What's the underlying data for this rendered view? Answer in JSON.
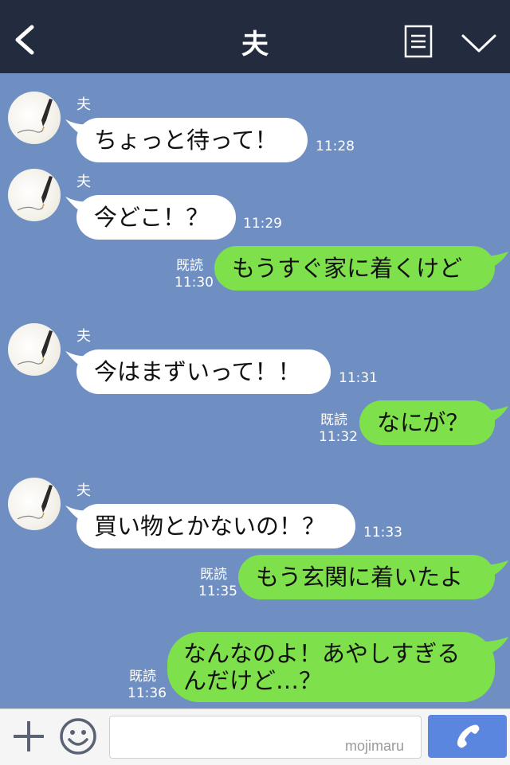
{
  "header": {
    "title": "夫",
    "back_icon": "chevron-left-icon",
    "menu_icon": "notes-icon",
    "collapse_icon": "chevron-down-icon"
  },
  "messages": [
    {
      "sender": "夫",
      "text": "ちょっと待って！",
      "time": "11:28"
    },
    {
      "sender": "夫",
      "text": "今どこ！？",
      "time": "11:29"
    },
    {
      "text": "もうすぐ家に着くけど",
      "read": "既読",
      "time": "11:30"
    },
    {
      "sender": "夫",
      "text": "今はまずいって！！",
      "time": "11:31"
    },
    {
      "text": "なにが？",
      "read": "既読",
      "time": "11:32"
    },
    {
      "sender": "夫",
      "text": "買い物とかないの！？",
      "time": "11:33"
    },
    {
      "text": "もう玄関に着いたよ",
      "read": "既読",
      "time": "11:35"
    },
    {
      "text": "なんなのよ！あやしすぎるんだけど…？",
      "read": "既読",
      "time": "11:36"
    }
  ],
  "footer": {
    "plus_icon": "plus-icon",
    "sticker_icon": "smiley-icon",
    "input_value": "",
    "call_icon": "phone-icon",
    "watermark": "mojimaru"
  },
  "colors": {
    "header_bg": "#232b3f",
    "chat_bg": "#6f8fc3",
    "incoming_bubble": "#ffffff",
    "outgoing_bubble": "#7ee04a",
    "call_button": "#5b86e0"
  }
}
